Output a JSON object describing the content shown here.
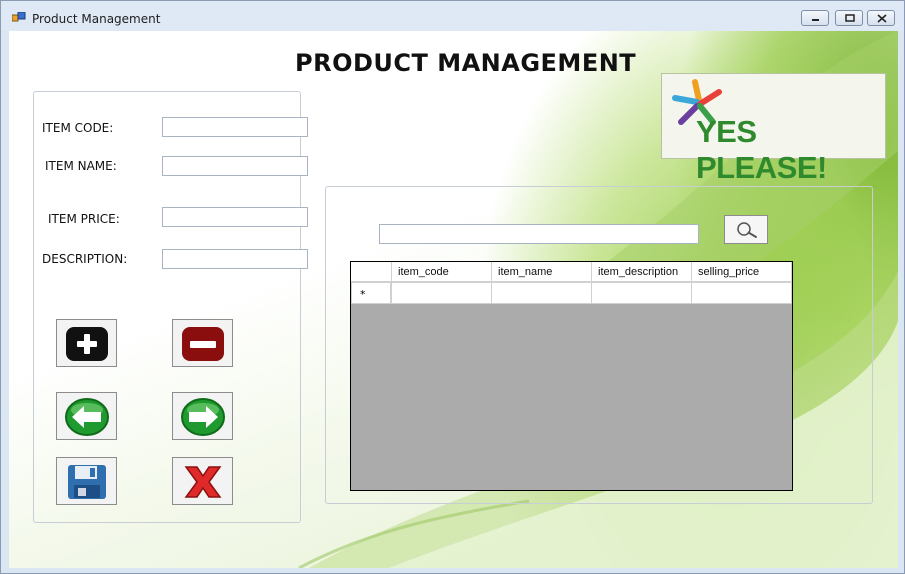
{
  "window": {
    "title": "Product Management",
    "controls": {
      "minimize": "minimize-icon",
      "maximize": "maximize-icon",
      "close": "close-icon"
    }
  },
  "header": {
    "title": "PRODUCT MANAGEMENT"
  },
  "logo": {
    "text": "YES PLEASE!"
  },
  "form": {
    "item_code": {
      "label": "ITEM CODE:",
      "value": ""
    },
    "item_name": {
      "label": "ITEM NAME:",
      "value": ""
    },
    "item_price": {
      "label": "ITEM PRICE:",
      "value": ""
    },
    "description": {
      "label": "DESCRIPTION:",
      "value": ""
    }
  },
  "actions": [
    {
      "name": "add",
      "icon": "plus-icon"
    },
    {
      "name": "delete",
      "icon": "minus-icon"
    },
    {
      "name": "previous",
      "icon": "arrow-left-icon"
    },
    {
      "name": "next",
      "icon": "arrow-right-icon"
    },
    {
      "name": "save",
      "icon": "floppy-disk-icon"
    },
    {
      "name": "cancel",
      "icon": "red-x-icon"
    }
  ],
  "search": {
    "value": "",
    "button_icon": "magnifier-icon"
  },
  "table": {
    "columns": [
      "item_code",
      "item_name",
      "item_description",
      "selling_price"
    ],
    "new_row_marker": "*",
    "rows": []
  },
  "colors": {
    "accent_green": "#2f8a2e",
    "grid_background": "#ababab"
  }
}
